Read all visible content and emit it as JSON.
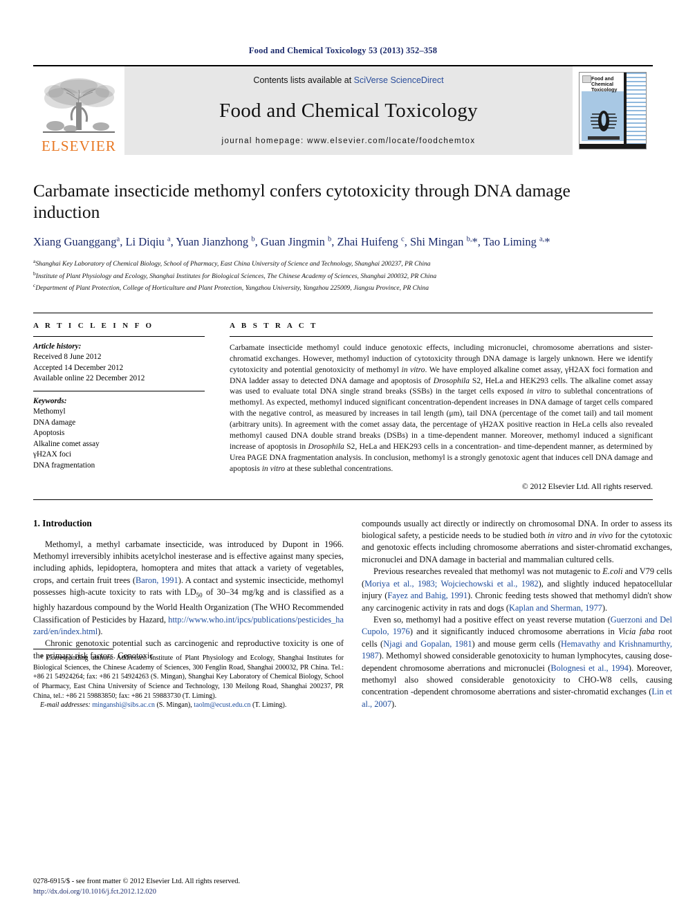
{
  "running_head": "Food and Chemical Toxicology 53 (2013) 352–358",
  "masthead": {
    "publisher_logo_text": "ELSEVIER",
    "contents_prefix": "Contents lists available at ",
    "contents_link": "SciVerse ScienceDirect",
    "journal_title": "Food and Chemical Toxicology",
    "homepage": "journal homepage: www.elsevier.com/locate/foodchemtox",
    "cover_title_line1": "Food and",
    "cover_title_line2": "Chemical",
    "cover_title_line3": "Toxicology"
  },
  "article": {
    "title": "Carbamate insecticide methomyl confers cytotoxicity through DNA damage induction",
    "authors_html": "Xiang Guanggang<sup>a</sup>, Li Diqiu <sup>a</sup>, Yuan Jianzhong <sup>b</sup>, Guan Jingmin <sup>b</sup>, Zhai Huifeng <sup>c</sup>, Shi Mingan <sup>b,</sup>*, Tao Liming <sup>a,</sup>*",
    "affiliations": [
      {
        "marker": "a",
        "text": "Shanghai Key Laboratory of Chemical Biology, School of Pharmacy, East China University of Science and Technology, Shanghai 200237, PR China"
      },
      {
        "marker": "b",
        "text": "Institute of Plant Physiology and Ecology, Shanghai Institutes for Biological Sciences, The Chinese Academy of Sciences, Shanghai 200032, PR China"
      },
      {
        "marker": "c",
        "text": "Department of Plant Protection, College of Horticulture and Plant Protection, Yangzhou University, Yangzhou 225009, Jiangsu Province, PR China"
      }
    ]
  },
  "article_info": {
    "heading": "A R T I C L E    I N F O",
    "history_label": "Article history:",
    "history": [
      "Received 8 June 2012",
      "Accepted 14 December 2012",
      "Available online 22 December 2012"
    ],
    "keywords_label": "Keywords:",
    "keywords": [
      "Methomyl",
      "DNA damage",
      "Apoptosis",
      "Alkaline comet assay",
      "γH2AX foci",
      "DNA fragmentation"
    ]
  },
  "abstract": {
    "heading": "A B S T R A C T",
    "text_html": "Carbamate insecticide methomyl could induce genotoxic effects, including micronuclei, chromosome aberrations and sister-chromatid exchanges. However, methomyl induction of cytotoxicity through DNA damage is largely unknown. Here we identify cytotoxicity and potential genotoxicity of methomyl <em>in vitro</em>. We have employed alkaline comet assay, γH2AX foci formation and DNA ladder assay to detected DNA damage and apoptosis of <em>Drosophila</em> S2, HeLa and HEK293 cells. The alkaline comet assay was used to evaluate total DNA single strand breaks (SSBs) in the target cells exposed <em>in vitro</em> to sublethal concentrations of methomyl. As expected, methomyl induced significant concentration-dependent increases in DNA damage of target cells compared with the negative control, as measured by increases in tail length (μm), tail DNA (percentage of the comet tail) and tail moment (arbitrary units). In agreement with the comet assay data, the percentage of γH2AX positive reaction in HeLa cells also revealed methomyl caused DNA double strand breaks (DSBs) in a time-dependent manner. Moreover, methomyl induced a significant increase of apoptosis in <em>Drosophila</em> S2, HeLa and HEK293 cells in a concentration- and time-dependent manner, as determined by Urea PAGE DNA fragmentation analysis. In conclusion, methomyl is a strongly genotoxic agent that induces cell DNA damage and apoptosis <em>in vitro</em> at these sublethal concentrations.",
    "copyright": "© 2012 Elsevier Ltd. All rights reserved."
  },
  "introduction": {
    "section_title": "1. Introduction",
    "left_paragraphs_html": [
      "Methomyl, a methyl carbamate insecticide, was introduced by Dupont in 1966. Methomyl irreversibly inhibits acetylchol inesterase and is effective against many species, including aphids, lepidoptera, homoptera and mites that attack a variety of vegetables, crops, and certain fruit trees (<span class=\"cite\">Baron, 1991</span>). A contact and systemic insecticide, methomyl possesses high-acute toxicity to rats with LD<sub class=\"small\">50</sub> of 30–34 mg/kg and is classified as a highly hazardous compound by the World Health Organization (The WHO Recommended Classification of Pesticides by Hazard, <span class=\"ext-link\">http://www.who.int/ipcs/publications/pesticides_hazard/en/index.html</span>).",
      "Chronic genotoxic potential such as carcinogenic and reproductive toxicity is one of the primary risk factors. Genotoxic"
    ],
    "right_paragraphs_html": [
      "compounds usually act directly or indirectly on chromosomal DNA. In order to assess its biological safety, a pesticide needs to be studied both <em>in vitro</em> and <em>in vivo</em> for the cytotoxic and genotoxic effects including chromosome aberrations and sister-chromatid exchanges, micronuclei and DNA damage in bacterial and mammalian cultured cells.",
      "Previous researches revealed that methomyl was not mutagenic to <em>E.coli</em> and V79 cells (<span class=\"cite\">Moriya et al., 1983; Wojciechowski et al., 1982</span>), and slightly induced hepatocellular injury (<span class=\"cite\">Fayez and Bahig, 1991</span>). Chronic feeding tests showed that methomyl didn't show any carcinogenic activity in rats and dogs (<span class=\"cite\">Kaplan and Sherman, 1977</span>).",
      "Even so, methomyl had a positive effect on yeast reverse mutation (<span class=\"cite\">Guerzoni and Del Cupolo, 1976</span>) and it significantly induced chromosome aberrations in <em>Vicia faba</em> root cells (<span class=\"cite\">Njagi and Gopalan, 1981</span>) and mouse germ cells (<span class=\"cite\">Hemavathy and Krishnamurthy, 1987</span>). Methomyl showed considerable genotoxicity to human lymphocytes, causing dose-dependent chromosome aberrations and micronuclei (<span class=\"cite\">Bolognesi et al., 1994</span>). Moreover, methomyl also showed considerable genotoxicity to CHO-W8 cells, causing concentration -dependent chromosome aberrations and sister-chromatid exchanges (<span class=\"cite\">Lin et al., 2007</span>)."
    ]
  },
  "footnotes": {
    "corresponding_html": "* Corresponding authors. Addresses: Institute of Plant Physiology and Ecology, Shanghai Institutes for Biological Sciences, the Chinese Academy of Sciences, 300 Fenglin Road, Shanghai 200032, PR China. Tel.: +86 21 54924264; fax: +86 21 54924263 (S. Mingan), Shanghai Key Laboratory of Chemical Biology, School of Pharmacy, East China University of Science and Technology, 130 Meilong Road, Shanghai 200237, PR China, tel.: +86 21 59883850; fax: +86 21 59883730 (T. Liming).",
    "email_html": "<em>E-mail addresses:</em> <span class=\"fn-link\">minganshi@sibs.ac.cn</span> (S. Mingan), <span class=\"fn-link\">taolm@ecust.edu.cn</span> (T. Liming)."
  },
  "page_footer": {
    "issn_line": "0278-6915/$ - see front matter © 2012 Elsevier Ltd. All rights reserved.",
    "doi_line": "http://dx.doi.org/10.1016/j.fct.2012.12.020"
  },
  "colors": {
    "accent_blue": "#1b2a6b",
    "link_blue": "#1b4a9b",
    "elsevier_orange": "#e87722",
    "masthead_grey": "#e7e7e7",
    "cover_blue": "#a8c8e4"
  }
}
